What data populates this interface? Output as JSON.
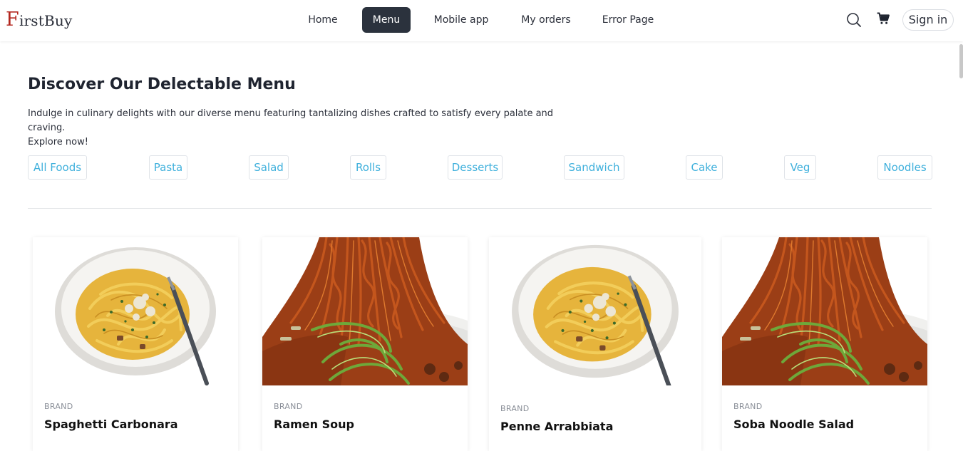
{
  "header": {
    "logo_first": "F",
    "logo_rest": "irstBuy",
    "nav": [
      {
        "label": "Home",
        "active": false
      },
      {
        "label": "Menu",
        "active": true
      },
      {
        "label": "Mobile app",
        "active": false
      },
      {
        "label": "My orders",
        "active": false
      },
      {
        "label": "Error Page",
        "active": false
      }
    ],
    "icons": [
      "search-icon",
      "cart-icon"
    ],
    "signin_label": "Sign in"
  },
  "hero": {
    "title": "Discover Our Delectable Menu",
    "description_line1": "Indulge in culinary delights with our diverse menu featuring tantalizing dishes crafted to satisfy every palate and craving.",
    "description_line2": "Explore now!"
  },
  "categories": [
    "All Foods",
    "Pasta",
    "Salad",
    "Rolls",
    "Desserts",
    "Sandwich",
    "Cake",
    "Veg",
    "Noodles"
  ],
  "products": [
    {
      "brand": "BRAND",
      "name": "Spaghetti Carbonara",
      "image": "spaghetti-bowl"
    },
    {
      "brand": "BRAND",
      "name": "Ramen Soup",
      "image": "noodles-lifted"
    },
    {
      "brand": "BRAND",
      "name": "Penne Arrabbiata",
      "image": "spaghetti-bowl"
    },
    {
      "brand": "BRAND",
      "name": "Soba Noodle Salad",
      "image": "noodles-lifted"
    }
  ],
  "colors": {
    "accent_active_nav": "#2b323d",
    "chip_text": "#3fb0dc",
    "logo_letter": "#b3261e"
  }
}
